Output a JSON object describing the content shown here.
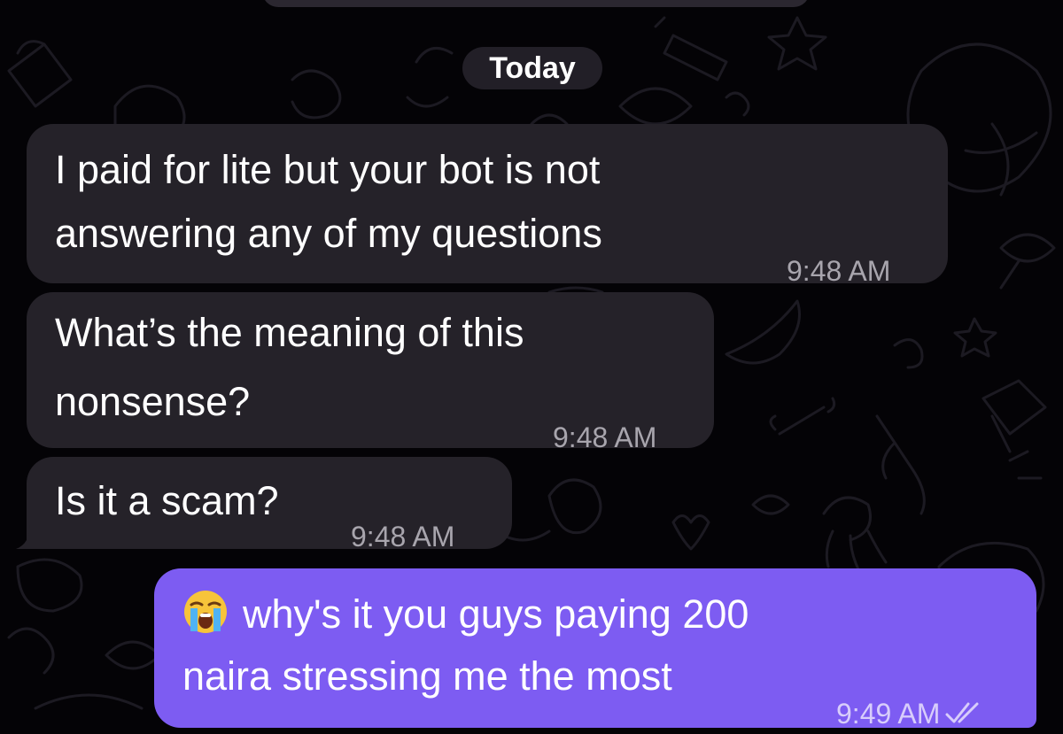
{
  "date_separator": "Today",
  "messages": [
    {
      "direction": "incoming",
      "lines": [
        "I paid for lite but your bot is not",
        "answering any of my questions"
      ],
      "time": "9:48 AM"
    },
    {
      "direction": "incoming",
      "lines": [
        "What’s the meaning of this",
        "nonsense?"
      ],
      "time": "9:48 AM"
    },
    {
      "direction": "incoming",
      "lines": [
        "Is it a scam?"
      ],
      "time": "9:48 AM"
    },
    {
      "direction": "outgoing",
      "emoji": "loudly-crying-face",
      "lines": [
        "why's it you guys paying 200",
        "naira stressing me the most"
      ],
      "time": "9:49 AM",
      "status": "read"
    }
  ],
  "colors": {
    "background": "#040306",
    "incoming_bubble": "#252229",
    "outgoing_bubble": "#7d5cf2",
    "date_pill": "#221f27",
    "incoming_time": "#a8a5ad",
    "outgoing_time": "#d8cdfb"
  }
}
